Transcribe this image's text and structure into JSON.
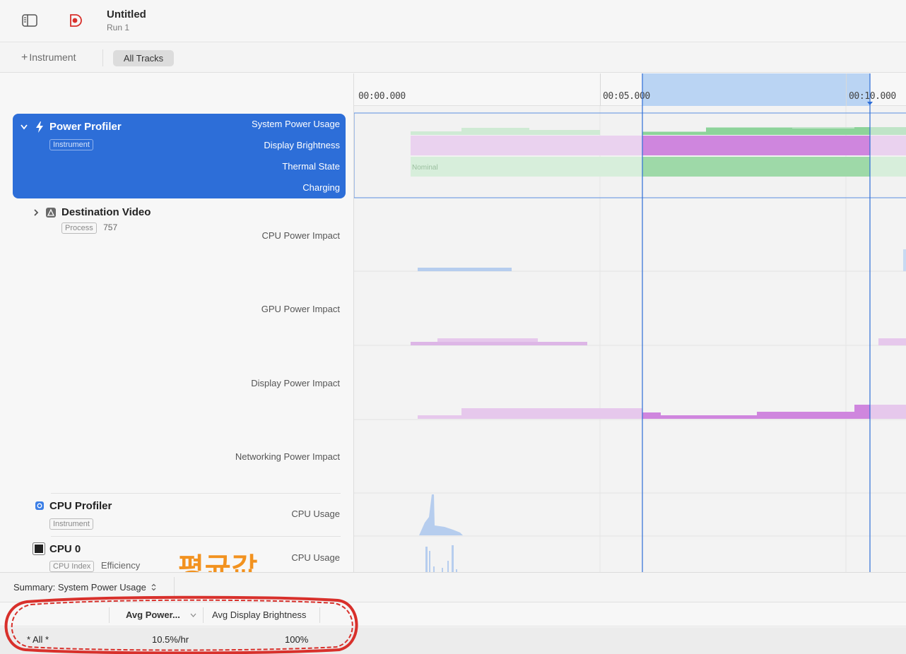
{
  "window": {
    "title": "Untitled",
    "subtitle": "Run 1"
  },
  "toolbar": {
    "add_instrument_label": "Instrument",
    "all_tracks_label": "All Tracks"
  },
  "ruler": {
    "ticks": [
      "00:00.000",
      "00:05.000",
      "00:10.000"
    ]
  },
  "tracks": {
    "power_profiler": {
      "name": "Power Profiler",
      "badge": "Instrument",
      "lanes": [
        "System Power Usage",
        "Display Brightness",
        "Thermal State",
        "Charging"
      ],
      "thermal_state_value": "Nominal"
    },
    "destination_video": {
      "name": "Destination Video",
      "badge": "Process",
      "pid": "757",
      "lanes": [
        "CPU Power Impact",
        "GPU Power Impact",
        "Display Power Impact",
        "Networking Power Impact"
      ]
    },
    "cpu_profiler": {
      "name": "CPU Profiler",
      "badge": "Instrument",
      "lane": "CPU Usage"
    },
    "cpu0": {
      "name": "CPU 0",
      "badge": "CPU Index",
      "core_type": "Efficiency",
      "lane": "CPU Usage"
    }
  },
  "annotation": {
    "text": "평균값"
  },
  "summary": {
    "selector_label": "Summary: System Power Usage"
  },
  "table": {
    "columns": [
      "Avg Power...",
      "Avg Display Brightness"
    ],
    "rows": [
      {
        "name": "* All *",
        "avg_power": "10.5%/hr",
        "avg_display_brightness": "100%"
      }
    ]
  },
  "colors": {
    "selection_blue": "#2d6ed8",
    "system_power_green": "#8dd39a",
    "display_purple": "#cf86de",
    "annotation_orange": "#f2921f",
    "highlight_red": "#d8302b"
  },
  "icons": {
    "sidebar_toggle": "sidebar-icon",
    "record": "record-icon",
    "power_profiler": "bolt-icon",
    "destination_video": "app-icon",
    "cpu_profiler": "cpu-profiler-icon",
    "cpu0": "chip-icon"
  }
}
